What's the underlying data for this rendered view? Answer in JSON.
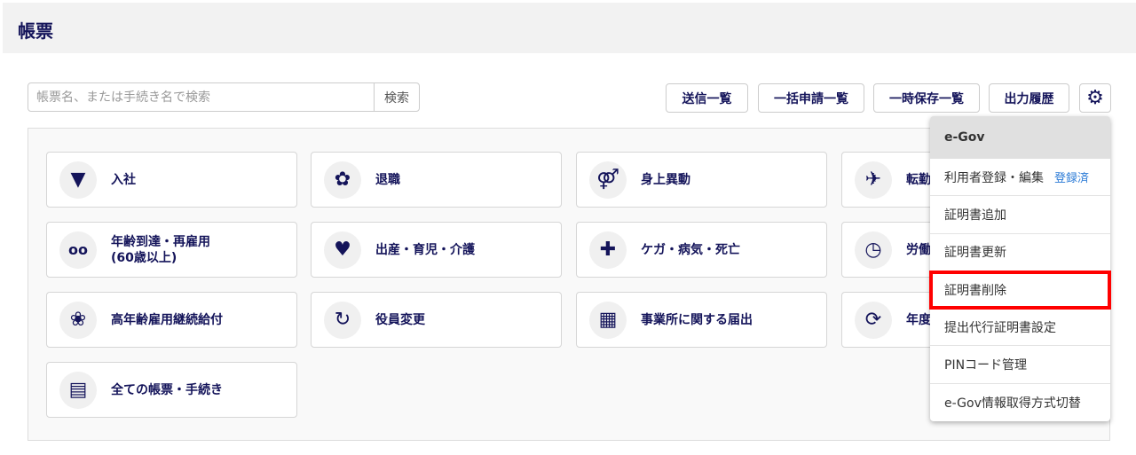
{
  "header": {
    "title": "帳票"
  },
  "search": {
    "placeholder": "帳票名、または手続き名で検索",
    "button": "検索"
  },
  "toolbar": {
    "sent_list": "送信一覧",
    "bulk_list": "一括申請一覧",
    "temp_list": "一時保存一覧",
    "output_history": "出力履歴"
  },
  "cards": [
    {
      "label": "入社",
      "icon": "tie"
    },
    {
      "label": "退職",
      "icon": "bouquet"
    },
    {
      "label": "身上異動",
      "icon": "couple"
    },
    {
      "label": "転勤",
      "icon": "airplane"
    },
    {
      "label": "年齢到達・再雇用",
      "label2": "(60歳以上)",
      "icon": "glasses"
    },
    {
      "label": "出産・育児・介護",
      "icon": "heart"
    },
    {
      "label": "ケガ・病気・死亡",
      "icon": "first-aid"
    },
    {
      "label": "労働",
      "icon": "clock"
    },
    {
      "label": "高年齢雇用継続給付",
      "icon": "leaf"
    },
    {
      "label": "役員変更",
      "icon": "refresh"
    },
    {
      "label": "事業所に関する届出",
      "icon": "building"
    },
    {
      "label": "年度",
      "icon": "sync"
    },
    {
      "label": "全ての帳票・手続き",
      "icon": "documents"
    }
  ],
  "menu": {
    "header": "e-Gov",
    "items": [
      {
        "label": "利用者登録・編集",
        "badge": "登録済"
      },
      {
        "label": "証明書追加"
      },
      {
        "label": "証明書更新"
      },
      {
        "label": "証明書削除"
      },
      {
        "label": "提出代行証明書設定"
      },
      {
        "label": "PINコード管理"
      },
      {
        "label": "e-Gov情報取得方式切替"
      }
    ]
  },
  "colors": {
    "brand": "#14145a",
    "highlight": "#ff0000",
    "link": "#2a7ad6"
  }
}
